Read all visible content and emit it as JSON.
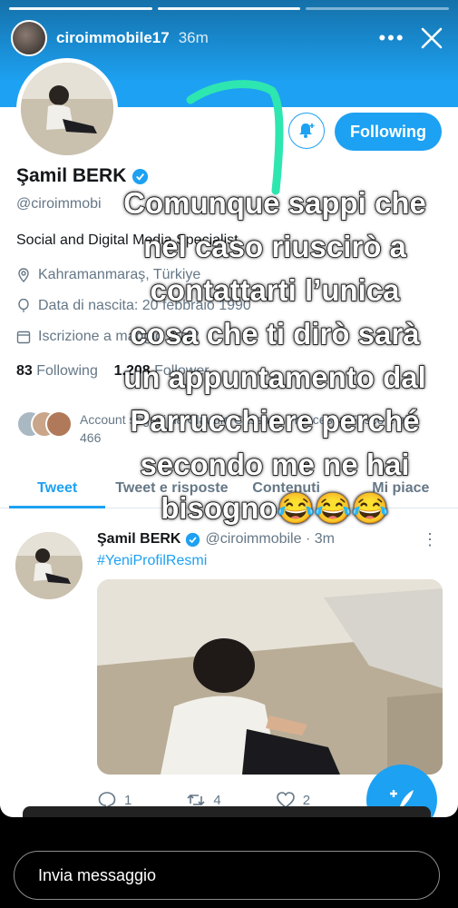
{
  "story": {
    "username": "ciroimmobile17",
    "time": "36m",
    "more_label": "•••",
    "progress_segments": 3,
    "progress_done": 2,
    "reply_placeholder": "Invia messaggio"
  },
  "profile": {
    "follow_label": "Following",
    "name": "Şamil BERK",
    "handle": "@ciroimmobi",
    "bio": "Social and Digital Media Specialist",
    "location": "Kahramanmaraş, Türkiye",
    "birth": "Data di nascita: 20 febbraio 1990",
    "joined": "Iscrizione a maggio 2012",
    "following_count": "83",
    "following_label": "Following",
    "followers_count": "1.208",
    "followers_label": "Follower",
    "followed_by": "Account seguiti da Claudio Cassani, Francesca Fusco e altri 466"
  },
  "tabs": [
    {
      "label": "Tweet"
    },
    {
      "label": "Tweet e risposte"
    },
    {
      "label": "Contenuti"
    },
    {
      "label": "Mi piace"
    }
  ],
  "tweet": {
    "name": "Şamil BERK",
    "handle": "@ciroimmobile · 3m",
    "hashtag": "#YeniProfilResmi",
    "replies": "1",
    "retweets": "4",
    "likes": "2"
  },
  "caption_lines": [
    "Comunque sappi che",
    "nel caso riuscirò a",
    "contattarti l’unica",
    "cosa che ti dirò sarà",
    "un appuntamento dal",
    "Parrucchiere perché",
    "secondo me ne hai",
    "bisogno😂😂😂"
  ],
  "colors": {
    "twitter_blue": "#1da1f2",
    "scribble": "#2ee6b0"
  }
}
